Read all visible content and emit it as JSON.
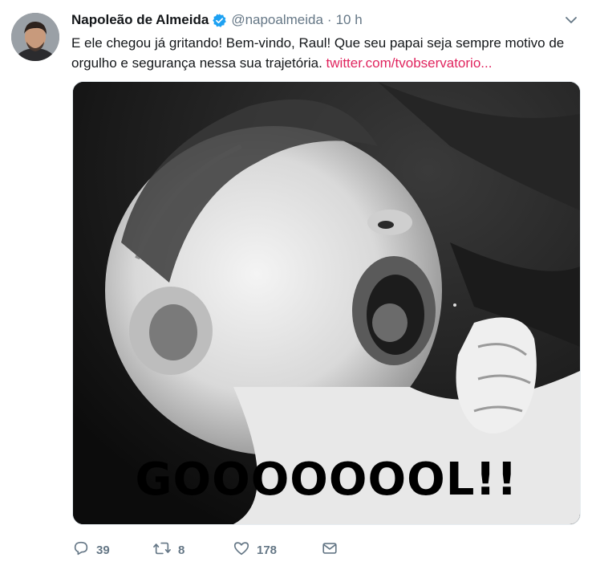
{
  "tweet": {
    "author_name": "Napoleão de Almeida",
    "handle": "@napoalmeida",
    "separator": "·",
    "time": "10 h",
    "text": "E ele chegou já gritando! Bem-vindo, Raul! Que seu papai seja sempre motivo de orgulho e segurança nessa sua trajetória.",
    "link_text": "twitter.com/tvobservatorio...",
    "media_caption": "GOOOOOOOL!!",
    "replies": "39",
    "retweets": "8",
    "likes": "178"
  },
  "colors": {
    "link": "#e0245e",
    "verified": "#1da1f2",
    "secondary_text": "#657786"
  },
  "icons": {
    "verified": "verified-badge-icon",
    "caret": "chevron-down-icon",
    "reply": "reply-icon",
    "retweet": "retweet-icon",
    "like": "heart-icon",
    "dm": "envelope-icon"
  }
}
